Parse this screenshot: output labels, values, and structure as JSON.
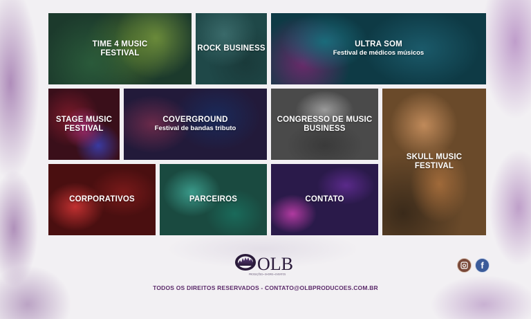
{
  "tiles": [
    {
      "id": "time4",
      "title": "TIME 4 MUSIC\nFESTIVAL",
      "subtitle": ""
    },
    {
      "id": "rock",
      "title": "ROCK BUSINESS",
      "subtitle": ""
    },
    {
      "id": "ultra",
      "title": "ULTRA SOM",
      "subtitle": "Festival de médicos músicos"
    },
    {
      "id": "stage",
      "title": "STAGE MUSIC\nFESTIVAL",
      "subtitle": ""
    },
    {
      "id": "cover",
      "title": "COVERGROUND",
      "subtitle": "Festival de bandas tributo"
    },
    {
      "id": "congresso",
      "title": "CONGRESSO DE MUSIC\nBUSINESS",
      "subtitle": ""
    },
    {
      "id": "skull",
      "title": "SKULL MUSIC\nFESTIVAL",
      "subtitle": ""
    },
    {
      "id": "corp",
      "title": "CORPORATIVOS",
      "subtitle": ""
    },
    {
      "id": "parc",
      "title": "PARCEIROS",
      "subtitle": ""
    },
    {
      "id": "contato",
      "title": "CONTATO",
      "subtitle": ""
    }
  ],
  "footer": {
    "logo_text": "OLB",
    "logo_tagline": "PRODUÇÕES • SHOWS • EVENTOS",
    "rights": "TODOS OS DIREITOS RESERVADOS - CONTATO@OLBPRODUCOES.COM.BR",
    "social": [
      {
        "name": "instagram",
        "icon": "instagram-icon"
      },
      {
        "name": "facebook",
        "icon": "facebook-icon",
        "glyph": "f"
      }
    ]
  },
  "colors": {
    "footer_text": "#5b2a6a",
    "background_paint": "#7a3c8c"
  }
}
